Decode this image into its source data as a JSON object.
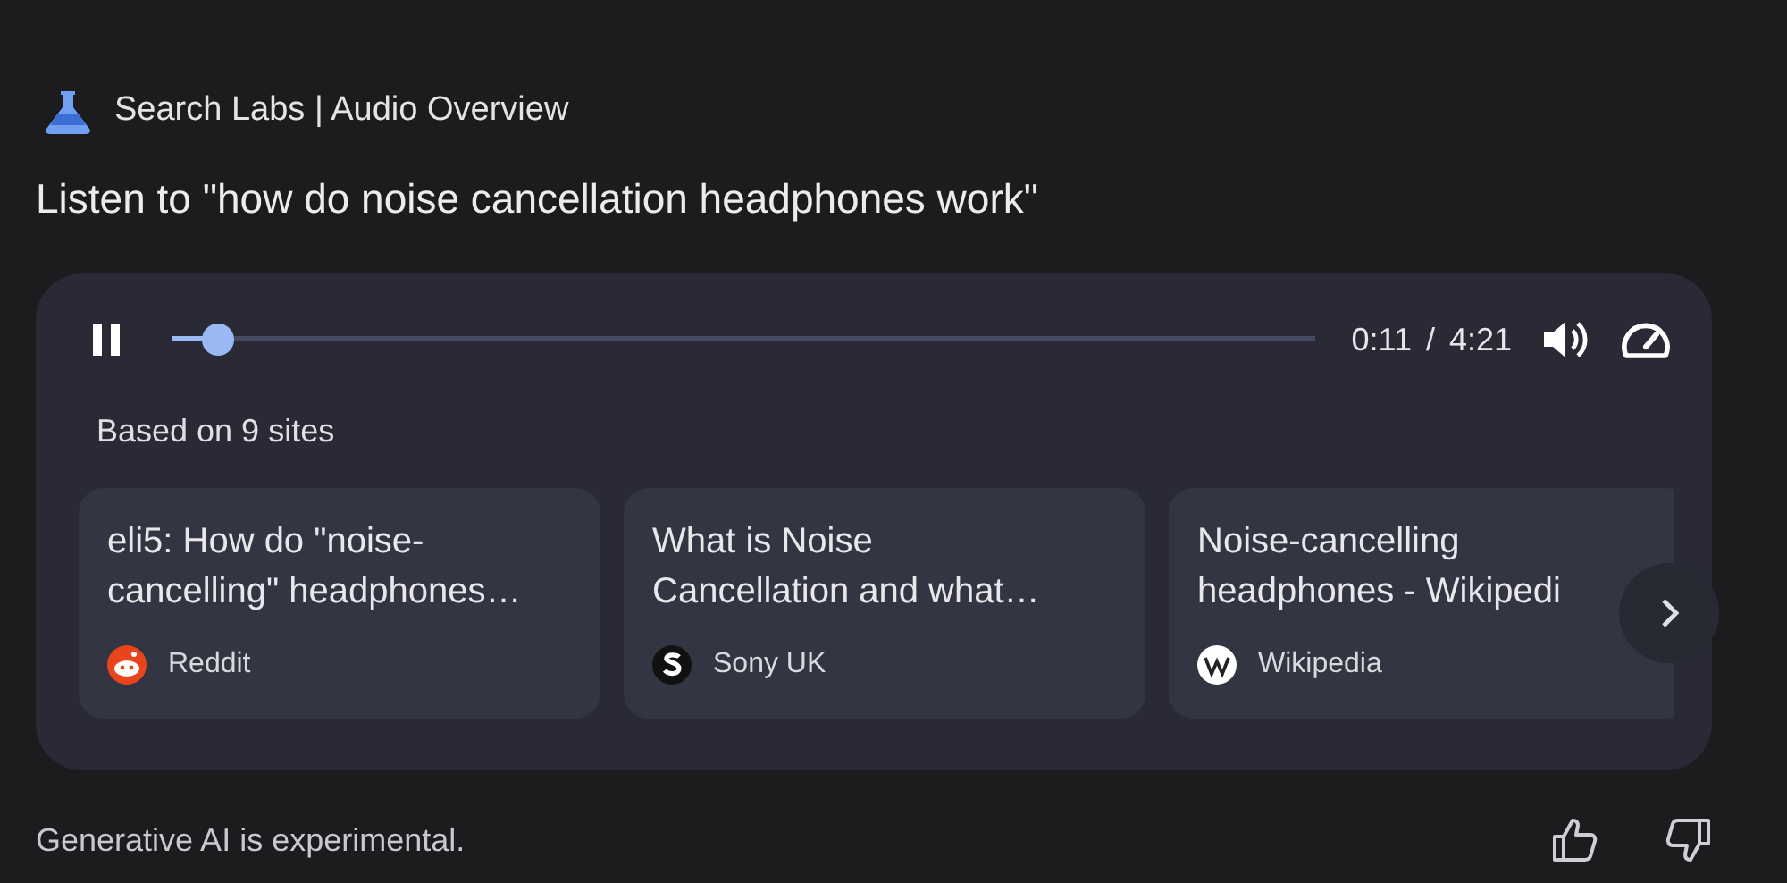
{
  "header": {
    "label": "Search Labs | Audio Overview"
  },
  "title": "Listen to \"how do noise cancellation headphones work\"",
  "player": {
    "playing": true,
    "level": 0.04,
    "time": "0:11 / 4:21"
  },
  "sources_label": "Based on 9 sites",
  "sources": [
    {
      "title": "eli5: How do \"noise-cancelling\" headphones…",
      "site": "Reddit",
      "kind": "reddit"
    },
    {
      "title": "What is Noise Cancellation and what…",
      "site": "Sony UK",
      "kind": "sony"
    },
    {
      "title": "Noise-cancelling headphones - Wikipedi",
      "site": "Wikipedia",
      "kind": "wikipedia"
    }
  ],
  "footer": "Generative AI is experimental."
}
